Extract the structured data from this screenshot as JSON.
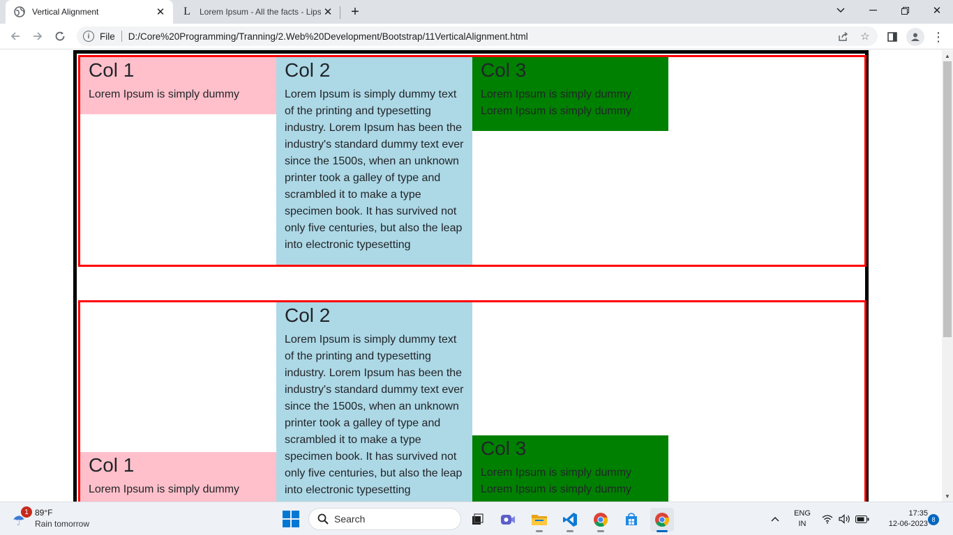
{
  "browser": {
    "tabs": [
      {
        "title": "Vertical Alignment",
        "favicon": "globe-icon",
        "active": true
      },
      {
        "title": "Lorem Ipsum - All the facts - Lipsum",
        "favicon": "lipsum-icon",
        "active": false
      }
    ],
    "address": {
      "scheme_label": "File",
      "url": "D:/Core%20Programming/Tranning/2.Web%20Development/Bootstrap/11VerticalAlignment.html"
    }
  },
  "page": {
    "row1": {
      "col1": {
        "heading": "Col 1",
        "text": "Lorem Ipsum is simply dummy"
      },
      "col2": {
        "heading": "Col 2",
        "text": "Lorem Ipsum is simply dummy text of the printing and typesetting industry. Lorem Ipsum has been the industry's standard dummy text ever since the 1500s, when an unknown printer took a galley of type and scrambled it to make a type specimen book. It has survived not only five centuries, but also the leap into electronic typesetting"
      },
      "col3": {
        "heading": "Col 3",
        "line1": "Lorem Ipsum is simply dummy",
        "line2": "Lorem Ipsum is simply dummy"
      }
    },
    "row2": {
      "col1": {
        "heading": "Col 1",
        "text": "Lorem Ipsum is simply dummy"
      },
      "col2": {
        "heading": "Col 2",
        "text": "Lorem Ipsum is simply dummy text of the printing and typesetting industry. Lorem Ipsum has been the industry's standard dummy text ever since the 1500s, when an unknown printer took a galley of type and scrambled it to make a type specimen book. It has survived not only five centuries, but also the leap into electronic typesetting"
      },
      "col3": {
        "heading": "Col 3",
        "line1": "Lorem Ipsum is simply dummy",
        "line2": "Lorem Ipsum is simply dummy"
      }
    },
    "colors": {
      "col1_bg": "#ffc0cb",
      "col2_bg": "#add8e6",
      "col3_bg": "#008000",
      "row_border": "#ff0000",
      "container_border": "#000000"
    }
  },
  "taskbar": {
    "weather": {
      "badge": "1",
      "temp": "89°F",
      "desc": "Rain tomorrow"
    },
    "search_label": "Search",
    "apps": [
      "task-view-icon",
      "teams-icon",
      "file-explorer-icon",
      "vscode-icon",
      "chrome-icon",
      "store-icon",
      "chrome-icon"
    ],
    "lang": {
      "line1": "ENG",
      "line2": "IN"
    },
    "clock": {
      "time": "17:35",
      "date": "12-06-2023"
    },
    "notification_count": "8"
  }
}
